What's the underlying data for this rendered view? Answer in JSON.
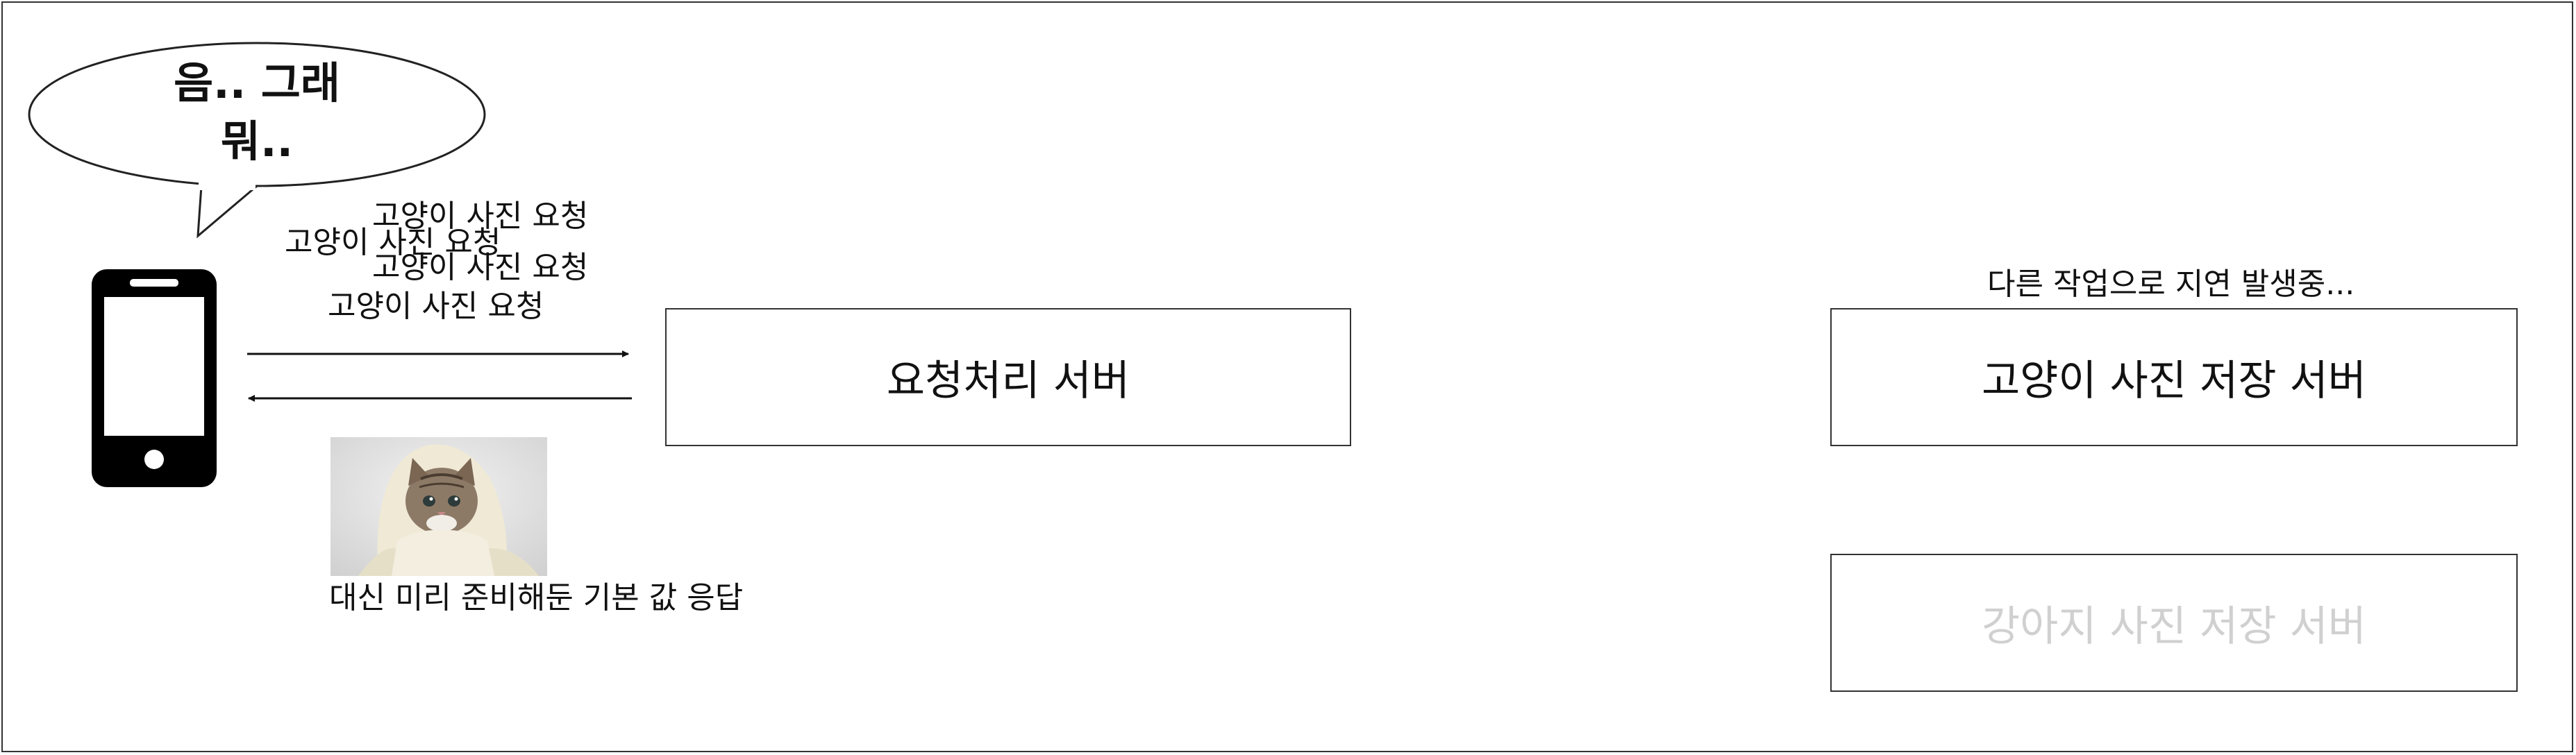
{
  "speech_bubble": {
    "line1": "음.. 그래",
    "line2": "뭐.."
  },
  "requests": {
    "label_a": "고양이 사진 요청",
    "label_b": "고양이 사진 요청",
    "label_c": "고양이 사진 요청",
    "label_d": "고양이 사진 요청"
  },
  "fallback_response_label": "대신 미리 준비해둔 기본 값 응답",
  "servers": {
    "request_server": "요청처리 서버",
    "cat_server": "고양이 사진 저장 서버",
    "dog_server": "강아지 사진 저장 서버",
    "cat_server_status": "다른 작업으로 지연 발생중..."
  },
  "colors": {
    "line": "#111111",
    "muted_text": "#d0d0d0"
  }
}
